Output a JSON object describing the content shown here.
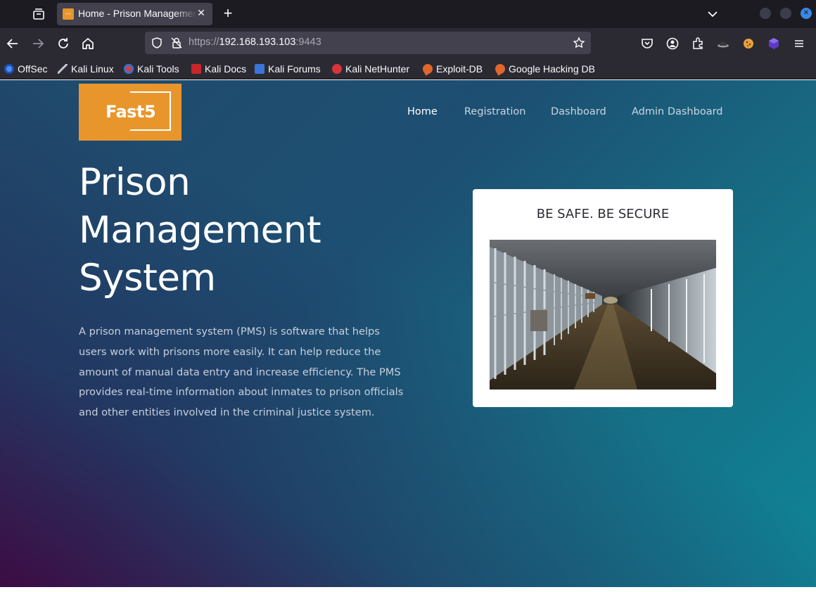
{
  "browser": {
    "tab": {
      "title": "Home - Prison Management System"
    },
    "url": {
      "scheme": "https://",
      "host": "192.168.193.103",
      "port": ":9443"
    },
    "bookmarks": [
      {
        "label": "OffSec",
        "icon": "offsec-icon"
      },
      {
        "label": "Kali Linux",
        "icon": "kali-linux-icon"
      },
      {
        "label": "Kali Tools",
        "icon": "kali-tools-icon"
      },
      {
        "label": "Kali Docs",
        "icon": "kali-docs-icon"
      },
      {
        "label": "Kali Forums",
        "icon": "kali-forums-icon"
      },
      {
        "label": "Kali NetHunter",
        "icon": "kali-nethunter-icon"
      },
      {
        "label": "Exploit-DB",
        "icon": "exploit-db-icon"
      },
      {
        "label": "Google Hacking DB",
        "icon": "google-hacking-db-icon"
      }
    ]
  },
  "site": {
    "logo_text": "Fast5",
    "nav": [
      {
        "label": "Home",
        "active": true
      },
      {
        "label": "Registration",
        "active": false
      },
      {
        "label": "Dashboard",
        "active": false
      },
      {
        "label": "Admin Dashboard",
        "active": false
      }
    ],
    "hero": {
      "title_lines": [
        "Prison",
        "Management",
        "System"
      ],
      "description": "A prison management system (PMS) is software that helps users work with prisons more easily. It can help reduce the amount of manual data entry and increase efficiency. The PMS provides real-time information about inmates to prison officials and other entities involved in the criminal justice system."
    },
    "card": {
      "title": "BE SAFE. BE SECURE"
    }
  },
  "colors": {
    "logo_bg": "#e8962c",
    "accent_blue": "#3987e5"
  }
}
